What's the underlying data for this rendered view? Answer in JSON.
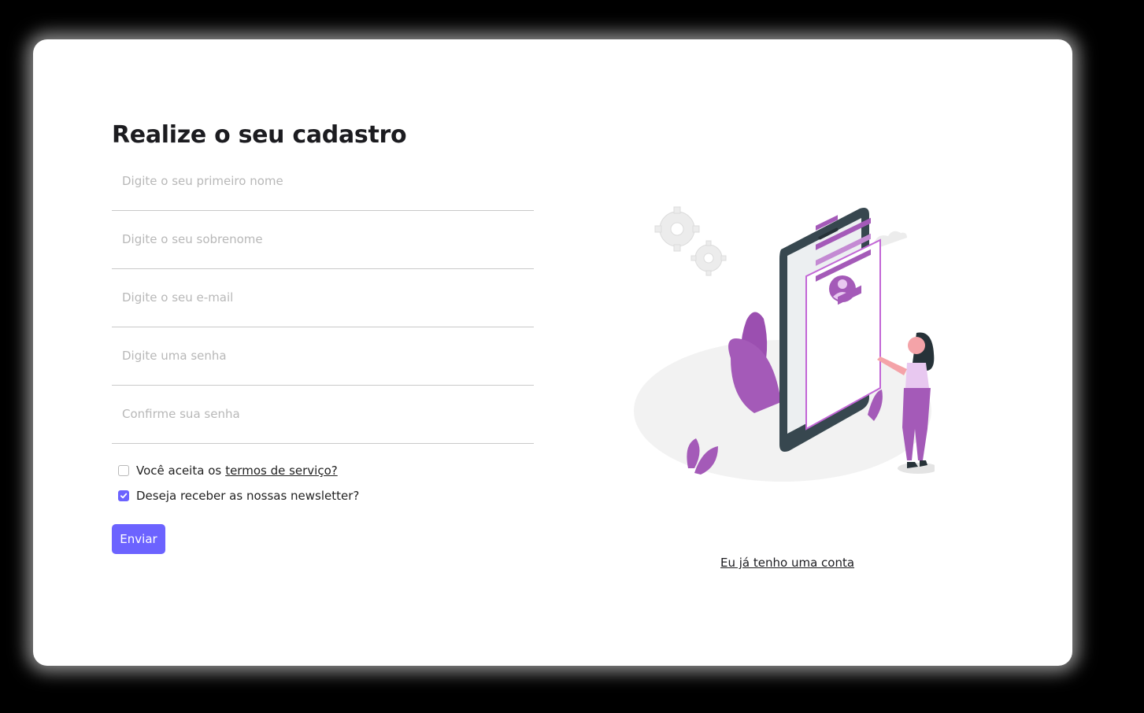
{
  "form": {
    "title": "Realize o seu cadastro",
    "fields": [
      {
        "placeholder": "Digite o seu primeiro nome"
      },
      {
        "placeholder": "Digite o seu sobrenome"
      },
      {
        "placeholder": "Digite o seu e-mail"
      },
      {
        "placeholder": "Digite uma senha"
      },
      {
        "placeholder": "Confirme sua senha"
      }
    ],
    "terms": {
      "prefix": "Você aceita os",
      "link": "termos de serviço?",
      "checked": false
    },
    "newsletter": {
      "label": "Deseja receber as nossas newsletter?",
      "checked": true
    },
    "submit_label": "Enviar"
  },
  "side": {
    "login_link": "Eu já tenho uma conta"
  },
  "colors": {
    "accent": "#6c63ff",
    "illustration_purple": "#a45ab8",
    "background": "#000000",
    "card": "#ffffff"
  },
  "icons": {
    "checkbox_check": "check-icon",
    "illustration": "signup-phone-illustration"
  }
}
